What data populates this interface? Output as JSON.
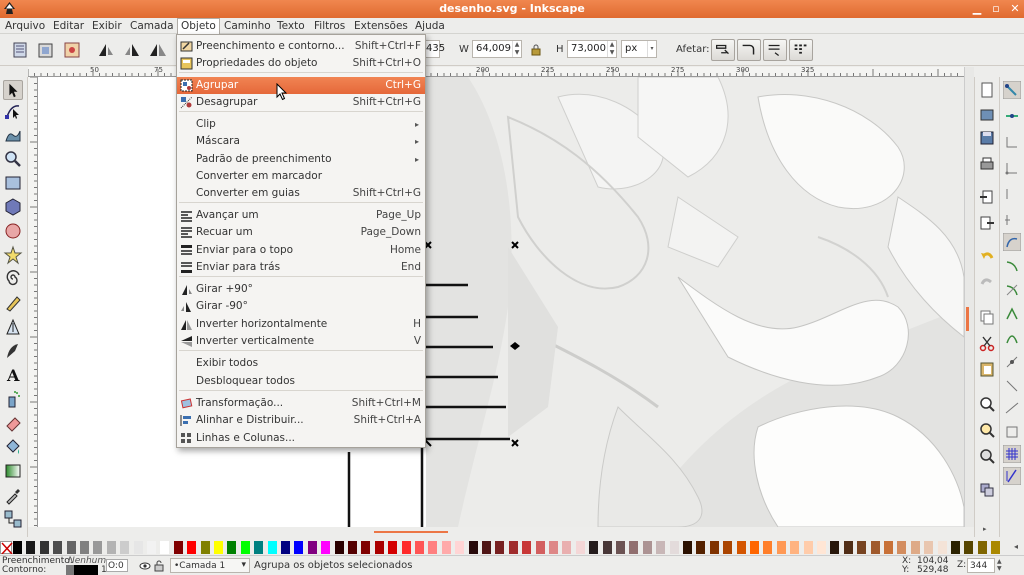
{
  "window": {
    "title": "desenho.svg - Inkscape"
  },
  "menubar": {
    "items": [
      "Arquivo",
      "Editar",
      "Exibir",
      "Camada",
      "Objeto",
      "Caminho",
      "Texto",
      "Filtros",
      "Extensões",
      "Ajuda"
    ],
    "active": "Objeto"
  },
  "controls": {
    "x_value_partial": "435",
    "w_label": "W",
    "w_value": "64,009",
    "h_label": "H",
    "h_value": "73,000",
    "unit": "px",
    "affect_label": "Afetar:"
  },
  "ruler": {
    "h_labels": [
      "50",
      "75",
      "200",
      "225",
      "250",
      "275",
      "300",
      "325"
    ],
    "v_labels": [
      "0",
      "5",
      "100",
      "150",
      "200",
      "250",
      "300",
      "350",
      "400"
    ]
  },
  "objeto_menu": {
    "items": [
      {
        "label": "Preenchimento e contorno...",
        "accel": "Shift+Ctrl+F",
        "icon": "fill-stroke-icon"
      },
      {
        "label": "Propriedades do objeto",
        "accel": "Shift+Ctrl+O",
        "icon": "object-properties-icon"
      },
      {
        "label": "Agrupar",
        "accel": "Ctrl+G",
        "icon": "group-icon",
        "highlighted": true
      },
      {
        "label": "Desagrupar",
        "accel": "Shift+Ctrl+G",
        "icon": "ungroup-icon"
      },
      {
        "label": "Clip",
        "submenu": true
      },
      {
        "label": "Máscara",
        "submenu": true
      },
      {
        "label": "Padrão de preenchimento",
        "submenu": true
      },
      {
        "label": "Converter em marcador"
      },
      {
        "label": "Converter em guias",
        "accel": "Shift+Ctrl+G"
      },
      {
        "label": "Avançar um",
        "accel": "Page_Up",
        "icon": "raise-icon"
      },
      {
        "label": "Recuar um",
        "accel": "Page_Down",
        "icon": "lower-icon"
      },
      {
        "label": "Enviar para o topo",
        "accel": "Home",
        "icon": "raise-to-top-icon"
      },
      {
        "label": "Enviar para trás",
        "accel": "End",
        "icon": "lower-to-bottom-icon"
      },
      {
        "label": "Girar +90°",
        "icon": "rotate-cw-icon"
      },
      {
        "label": "Girar -90°",
        "icon": "rotate-ccw-icon"
      },
      {
        "label": "Inverter horizontalmente",
        "accel": "H",
        "icon": "flip-horizontal-icon"
      },
      {
        "label": "Inverter verticalmente",
        "accel": "V",
        "icon": "flip-vertical-icon"
      },
      {
        "label": "Exibir todos"
      },
      {
        "label": "Desbloquear todos"
      },
      {
        "label": "Transformação...",
        "accel": "Shift+Ctrl+M",
        "icon": "transform-icon"
      },
      {
        "label": "Alinhar e Distribuir...",
        "accel": "Shift+Ctrl+A",
        "icon": "align-distribute-icon"
      },
      {
        "label": "Linhas e Colunas...",
        "icon": "rows-columns-icon"
      }
    ]
  },
  "status": {
    "fill_label": "Preenchimento:",
    "fill_value": "Nenhum",
    "stroke_label": "Contorno:",
    "stroke_value": "1",
    "opacity_label": "O:",
    "opacity_value": "0",
    "layer": "•Camada 1",
    "message": "Agrupa os objetos selecionados",
    "x_label": "X:",
    "x_value": "104,04",
    "y_label": "Y:",
    "y_value": "529,48",
    "zoom_label": "Z:",
    "zoom_value": "344"
  },
  "colors": {
    "title_bar": "#e8763f",
    "highlight": "#ec7645"
  }
}
